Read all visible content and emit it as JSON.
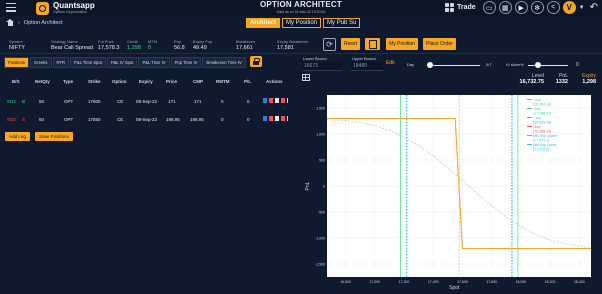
{
  "header": {
    "brand": "Quantsapp",
    "brand_sub": "Options Opportunities",
    "title": "OPTION ARCHITECT",
    "subtitle": "Data as on 31-Mar-22 15:30:00",
    "trade_label": "Trade",
    "avatar_letter": "V"
  },
  "breadcrumb": {
    "label": "Option Architect"
  },
  "tabs": [
    {
      "label": "Architect",
      "active": true
    },
    {
      "label": "My Position",
      "active": false
    },
    {
      "label": "My Pub Su",
      "active": false
    }
  ],
  "strategy": {
    "symbol_label": "Symbol",
    "symbol": "NIFTY",
    "name_label": "Strategy Name",
    "name": "Bear Call Spread",
    "fut_label": "Fut Price",
    "fut": "17,578.3",
    "credit_label": "Credit",
    "credit": "1,298",
    "mtm_label": "MTM",
    "mtm": "0",
    "pop_label": "Pop",
    "pop": "56.8",
    "epop_label": "Expiry Pop",
    "epop": "49.49",
    "be_label": "Breakeven",
    "be": "17,661",
    "ebe_label": "Expiry Breakeven",
    "ebe": "17,581"
  },
  "controls": {
    "reset": "Reset",
    "my_position": "My Position",
    "place_order": "Place Order"
  },
  "subtabs": [
    "Positions",
    "Greeks",
    "RTR",
    "P&L Time Spot",
    "P&L IV Spot",
    "P&L Time IV",
    "Pop Time IV",
    "Breakeven Time IV"
  ],
  "positions": {
    "headers": [
      "B/S",
      "NetQty",
      "Type",
      "Strike",
      "Option",
      "Expiry",
      "Price",
      "CMP",
      "RMTM",
      "P/L",
      "Actions"
    ],
    "rows": [
      {
        "id": "#1/2",
        "bs": "B",
        "netqty": "50",
        "type": "OPT",
        "strike": "17600",
        "option": "CE",
        "expiry": "08-Sep-22",
        "price": "171",
        "cmp": "171",
        "rmtm": "0",
        "pl": "0"
      },
      {
        "id": "#2/2",
        "bs": "S",
        "netqty": "50",
        "type": "OPT",
        "strike": "17550",
        "option": "CE",
        "expiry": "08-Sep-22",
        "price": "198.95",
        "cmp": "198.95",
        "rmtm": "0",
        "pl": "0"
      }
    ],
    "add_leg": "Add Leg",
    "save_positions": "Save Positions"
  },
  "chart_controls": {
    "lower_label": "Lower Bound",
    "lower_value": "16673",
    "upper_label": "Upper Bound",
    "upper_value": "18480",
    "edit": "Edit",
    "day_label": "Day",
    "day_value": "0/7",
    "iv_label": "IV slicer%",
    "iv_value": "0"
  },
  "level_box": {
    "level_label": "Level",
    "level": "16,732.75",
    "pnl_label": "PnL",
    "pnl": "1332",
    "expiry_label": "Expiry",
    "expiry": "1,298"
  },
  "chart_data": {
    "type": "line",
    "title": "",
    "xlabel": "Spot",
    "ylabel": "PnL",
    "xlim": [
      16673,
      18480
    ],
    "ylim": [
      -1750,
      1750
    ],
    "x_ticks": [
      "16,800",
      "17,000",
      "17,200",
      "17,400",
      "17,600",
      "17,800",
      "18,000",
      "18,200",
      "18,400"
    ],
    "y_ticks": [
      "1,500",
      "1,000",
      "500",
      "0",
      "-500",
      "-1,000",
      "-1,500"
    ],
    "series": [
      {
        "name": "Expiry",
        "color": "#f5a623",
        "x": [
          16673,
          17550,
          17600,
          18480
        ],
        "y": [
          1298,
          1298,
          -1202,
          -1202
        ]
      },
      {
        "name": "Day 0",
        "color": "#e6e9ef",
        "dashed": true,
        "x": [
          16673,
          16800,
          16900,
          17000,
          17100,
          17200,
          17300,
          17400,
          17500,
          17600,
          17700,
          17800,
          17900,
          18000,
          18100,
          18200,
          18300,
          18400,
          18480
        ],
        "y": [
          1280,
          1255,
          1220,
          1160,
          1070,
          940,
          780,
          580,
          350,
          110,
          -140,
          -380,
          -600,
          -780,
          -930,
          -1040,
          -1110,
          -1160,
          -1185
        ]
      }
    ],
    "vlines": [
      {
        "label": "+1sd",
        "x": 17175,
        "color": "#3ddc84"
      },
      {
        "label": "-1sd",
        "x": 17980,
        "color": "#3ddc84"
      },
      {
        "label": "+1sd",
        "x": 17220,
        "color": "#2ec5d9"
      },
      {
        "label": "-1sd",
        "x": 17935,
        "color": "#2ec5d9"
      },
      {
        "label": "Mkt Exp Upper",
        "x": 17941.1,
        "color": "#2ec5d9"
      },
      {
        "label": "Mkt Exp Lower",
        "x": 17215.6,
        "color": "#2ec5d9"
      },
      {
        "label": "Spot",
        "x": 17578.3,
        "color": "#e6e9ef"
      }
    ],
    "legend": [
      {
        "label": "+1sd",
        "value": "(16,064.18)",
        "color": "#3ddc84"
      },
      {
        "label": "-1sd",
        "value": "(17,088.42)",
        "color": "#3ddc84"
      },
      {
        "label": "+1sd",
        "value": "(16,594.16)",
        "color": "#2ec5d9"
      },
      {
        "label": "-1sd",
        "value": "(16,958.34)",
        "color": "#ff4d4d"
      },
      {
        "label": "Mkt Exp Upper",
        "value": "(17,941.1)",
        "color": "#2ec5d9"
      },
      {
        "label": "Mkt Exp Lower",
        "value": "(17,215.6)",
        "color": "#2ec5d9"
      }
    ]
  }
}
